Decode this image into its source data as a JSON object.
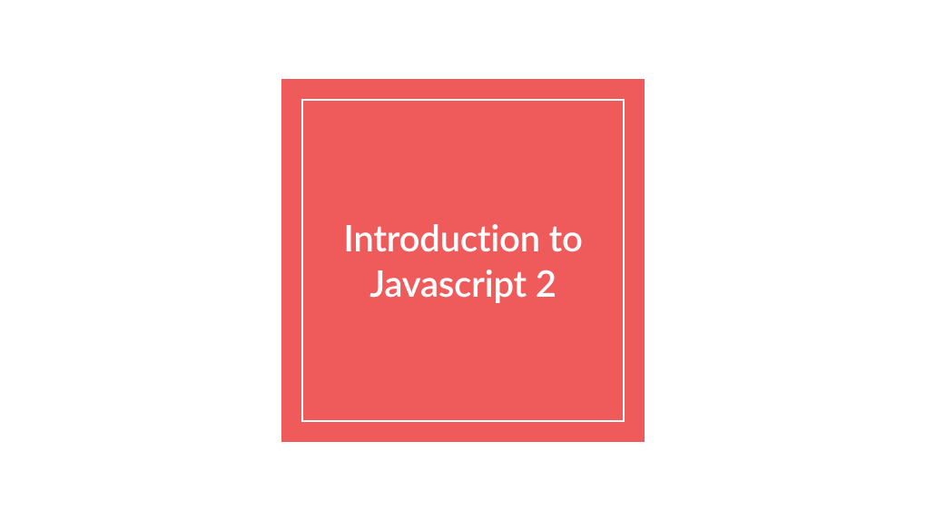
{
  "card": {
    "title": "Introduction to Javascript 2",
    "background_color": "#ef5a5a",
    "border_color": "#ffffff",
    "text_color": "#ffffff"
  }
}
